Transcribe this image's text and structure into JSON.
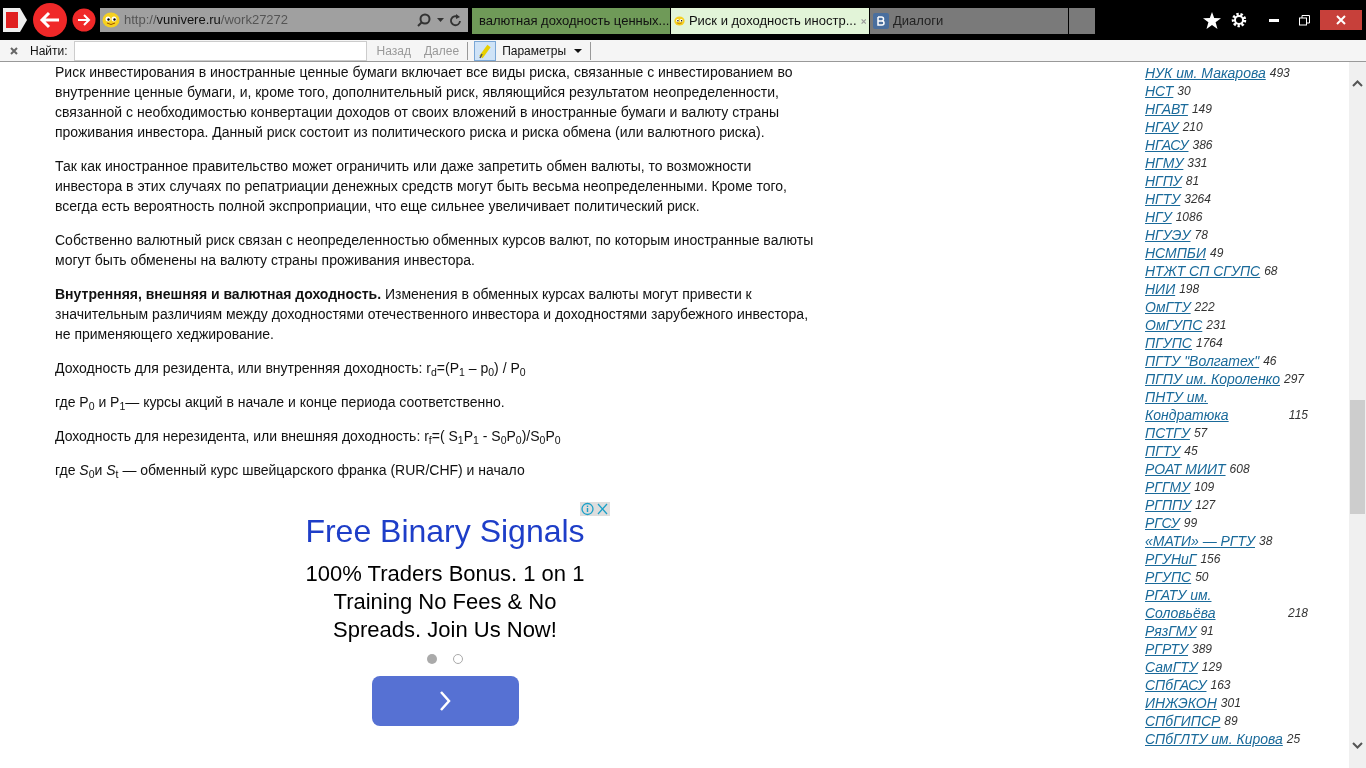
{
  "browser": {
    "address": {
      "host": "vunivere.ru",
      "path": "/work27272",
      "scheme": "http://"
    },
    "tabs": [
      {
        "title": "валютная доходность ценных...",
        "kind": "search",
        "selected": false
      },
      {
        "title": "Риск и доходность иностр...",
        "kind": "smiley",
        "selected": true
      },
      {
        "title": "Диалоги",
        "kind": "vk",
        "selected": false
      }
    ],
    "find_bar": {
      "label": "Найти:",
      "back": "Назад",
      "next": "Далее",
      "options": "Параметры"
    }
  },
  "article": {
    "paragraphs": [
      "Риск инвестирования в иностранные ценные бумаги включает все виды риска, связанные с инвестированием во внутренние ценные бумаги, и, кроме того, дополнительный риск, являющийся результатом неопределенности, связанной с необходимостью конвертации доходов от своих вложений в иностранные бумаги и валюту страны проживания инвестора. Данный риск состоит из политического риска и риска обмена (или валютного риска).",
      "Так как иностранное правительство может ограничить или даже запретить обмен валюты, то возможности инвестора в этих случаях по репатриации денежных средств могут быть весьма неопределенными. Кроме того, всегда есть вероятность полной экспроприации, что еще сильнее увеличивает политический риск.",
      "Собственно валютный риск связан с неопределенностью обменных курсов валют, по которым иностранные валюты могут быть обменены на валюту страны проживания инвестора.",
      "**Внутренняя, внешняя и валютная доходность.**  Изменения в обменных курсах валюты могут привести к значительным различиям между доходностями отечественного инвестора и доходностями зарубежного инвестора, не применяющего хеджирование.",
      "Доходность для резидента, или внутренняя доходность: r$_{d}$=(P$_{1}$ – p$_{0}$) / P$_{0}$",
      "где P$_{0}$ и P$_{1}$— курсы акций в начале и конце периода соответственно.",
      "Доходность для нерезидента, или внешняя доходность: r$_{f}$=( S$_{1}$P$_{1}$ - S$_{0}$P$_{0}$)/S$_{0}$P$_{0}$",
      "где *S*$_{0}$и *S*$_{t}$ — обменный курс швейцарского франка (RUR/CHF) и начало"
    ]
  },
  "ad": {
    "headline": "Free Binary Signals",
    "body": "100% Traders Bonus. 1 on 1 Training No Fees & No Spreads. Join Us Now!",
    "dots": [
      {
        "selected": true
      },
      {
        "selected": false
      }
    ]
  },
  "sidebar": {
    "items": [
      {
        "name": "НУК им. Макарова",
        "count": "493"
      },
      {
        "name": "НСТ",
        "count": "30"
      },
      {
        "name": "НГАВТ",
        "count": "149"
      },
      {
        "name": "НГАУ",
        "count": "210"
      },
      {
        "name": "НГАСУ",
        "count": "386"
      },
      {
        "name": "НГМУ",
        "count": "331"
      },
      {
        "name": "НГПУ",
        "count": "81"
      },
      {
        "name": "НГТУ",
        "count": "3264"
      },
      {
        "name": "НГУ",
        "count": "1086"
      },
      {
        "name": "НГУЭУ",
        "count": "78"
      },
      {
        "name": "НСМПБИ",
        "count": "49"
      },
      {
        "name": "НТЖТ СП СГУПС",
        "count": "68"
      },
      {
        "name": "НИИ",
        "count": "198"
      },
      {
        "name": "ОмГТУ",
        "count": "222"
      },
      {
        "name": "ОмГУПС",
        "count": "231"
      },
      {
        "name": "ПГУПС",
        "count": "1764"
      },
      {
        "name": "ПГТУ \"Волгатех\"",
        "count": "46"
      },
      {
        "name": "ПГПУ им. Короленко",
        "count": "297"
      },
      {
        "name": "ПНТУ им. Кондратюка",
        "count": "115"
      },
      {
        "name": "ПСТГУ",
        "count": "57"
      },
      {
        "name": "ПГТУ",
        "count": "45"
      },
      {
        "name": "РОАТ МИИТ",
        "count": "608"
      },
      {
        "name": "РГГМУ",
        "count": "109"
      },
      {
        "name": "РГППУ",
        "count": "127"
      },
      {
        "name": "РГСУ",
        "count": "99"
      },
      {
        "name": "«МАТИ» — РГТУ",
        "count": "38"
      },
      {
        "name": "РГУНиГ",
        "count": "156"
      },
      {
        "name": "РГУПС",
        "count": "50"
      },
      {
        "name": "РГАТУ им. Соловьёва",
        "count": "218"
      },
      {
        "name": "РязГМУ",
        "count": "91"
      },
      {
        "name": "РГРТУ",
        "count": "389"
      },
      {
        "name": "СамГТУ",
        "count": "129"
      },
      {
        "name": "СПбГАСУ",
        "count": "163"
      },
      {
        "name": "ИНЖЭКОН",
        "count": "301"
      },
      {
        "name": "СПбГИПСР",
        "count": "89"
      },
      {
        "name": "СПбГЛТУ им. Кирова",
        "count": "25"
      }
    ]
  }
}
